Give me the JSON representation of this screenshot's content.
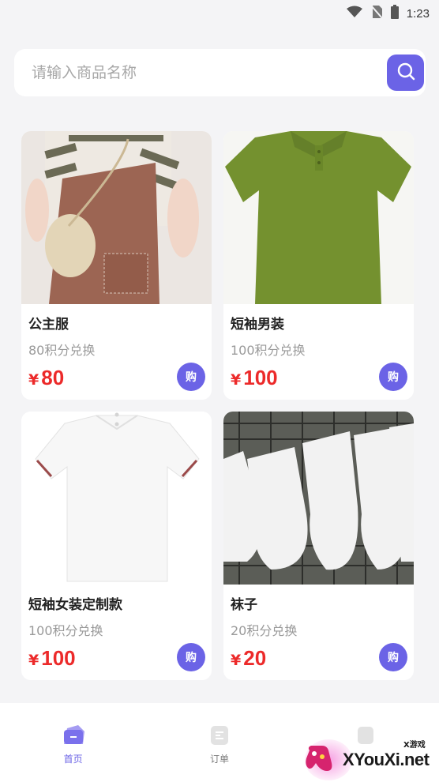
{
  "status_bar": {
    "time": "1:23"
  },
  "search": {
    "placeholder": "请输入商品名称",
    "value": ""
  },
  "products": [
    {
      "name": "公主服",
      "points": "80积分兑换",
      "currency": "¥",
      "price": "80",
      "buy_label": "购"
    },
    {
      "name": "短袖男装",
      "points": "100积分兑换",
      "currency": "¥",
      "price": "100",
      "buy_label": "购"
    },
    {
      "name": "短袖女装定制款",
      "points": "100积分兑换",
      "currency": "¥",
      "price": "100",
      "buy_label": "购"
    },
    {
      "name": "袜子",
      "points": "20积分兑换",
      "currency": "¥",
      "price": "20",
      "buy_label": "购"
    }
  ],
  "bottom_nav": {
    "items": [
      {
        "label": "首页",
        "icon": "home-icon",
        "active": true
      },
      {
        "label": "订单",
        "icon": "order-icon",
        "active": false
      },
      {
        "label": "",
        "icon": "profile-icon",
        "active": false
      }
    ]
  },
  "watermark": {
    "text": "XYouXi.net",
    "small": "X游戏"
  },
  "colors": {
    "accent": "#6b63e6",
    "price": "#ec2a2a",
    "background": "#f4f4f6"
  }
}
